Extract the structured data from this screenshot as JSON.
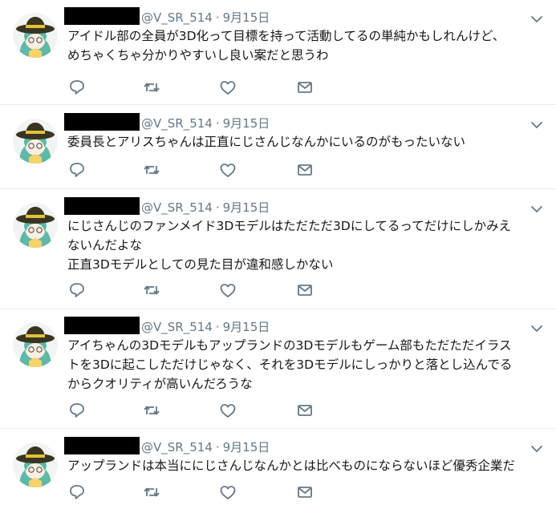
{
  "tweets": [
    {
      "handle": "@V_SR_514",
      "date": "9月15日",
      "lines": [
        "アイドル部の全員が3D化って目標を持って活動してるの単純かもしれんけど、",
        "めちゃくちゃ分かりやすいし良い案だと思うわ"
      ]
    },
    {
      "handle": "@V_SR_514",
      "date": "9月15日",
      "lines": [
        "委員長とアリスちゃんは正直にじさんじなんかにいるのがもったいない"
      ]
    },
    {
      "handle": "@V_SR_514",
      "date": "9月15日",
      "lines": [
        "にじさんじのファンメイド3Dモデルはただただ3Dにしてるってだけにしかみえ",
        "ないんだよな",
        "正直3Dモデルとしての見た目が違和感しかない"
      ]
    },
    {
      "handle": "@V_SR_514",
      "date": "9月15日",
      "lines": [
        "アイちゃんの3Dモデルもアップランドの3Dモデルもゲーム部もただただイラス",
        "トを3Dに起こしただけじゃなく、それを3Dモデルにしっかりと落とし込んでる",
        "からクオリティが高いんだろうな"
      ]
    },
    {
      "handle": "@V_SR_514",
      "date": "9月15日",
      "lines": [
        "アップランドは本当ににじさんじなんかとは比べものにならないほど優秀企業だ"
      ]
    }
  ],
  "separator": "·",
  "colors": {
    "text": "#14171a",
    "muted": "#657786",
    "border": "#e6ecf0",
    "redaction": "#000000",
    "avatar_hair": "#5fb8a8",
    "avatar_hat": "#3a3520",
    "avatar_hat_band": "#e2c23a"
  },
  "icons": [
    "chevron-down-icon",
    "reply-icon",
    "retweet-icon",
    "like-icon",
    "message-icon"
  ]
}
